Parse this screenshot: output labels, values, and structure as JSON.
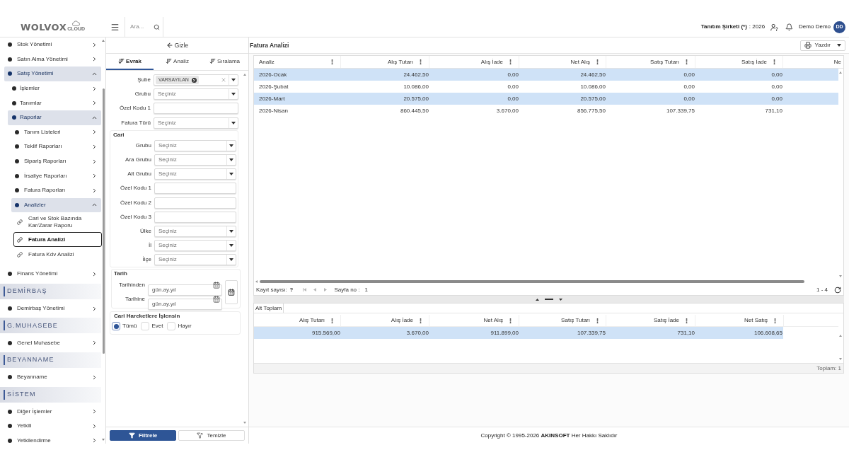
{
  "header": {
    "logo": {
      "wordmark": "WOLVOX",
      "tagline": "CLOUD"
    },
    "search": {
      "placeholder": "Ara..."
    },
    "company": {
      "name": "Tanıtım Şirketi (*)",
      "period": ": 2026"
    },
    "user": {
      "name": "Demo Demo",
      "initials": "DD"
    }
  },
  "sidebar": {
    "items": [
      {
        "kind": "node",
        "label": "Stok Yönetimi",
        "expanded": false
      },
      {
        "kind": "node",
        "label": "Satın Alma Yönetimi",
        "expanded": false
      },
      {
        "kind": "node",
        "label": "Satış Yönetimi",
        "expanded": true,
        "children": [
          {
            "kind": "node",
            "label": "İşlemler",
            "expanded": false
          },
          {
            "kind": "node",
            "label": "Tanımlar",
            "expanded": false
          },
          {
            "kind": "node",
            "label": "Raporlar",
            "expanded": true,
            "children": [
              {
                "kind": "node",
                "label": "Tanım Listeleri",
                "expanded": false
              },
              {
                "kind": "node",
                "label": "Teklif Raporları",
                "expanded": false
              },
              {
                "kind": "node",
                "label": "Sipariş Raporları",
                "expanded": false
              },
              {
                "kind": "node",
                "label": "İrsaliye Raporları",
                "expanded": false
              },
              {
                "kind": "node",
                "label": "Fatura Raporları",
                "expanded": false
              },
              {
                "kind": "node",
                "label": "Analizler",
                "expanded": true,
                "children": [
                  {
                    "kind": "link",
                    "label": "Cari ve Stok Bazında Kar/Zarar Raporu",
                    "selected": false
                  },
                  {
                    "kind": "link",
                    "label": "Fatura Analizi",
                    "selected": true
                  },
                  {
                    "kind": "link",
                    "label": "Fatura Kdv Analizi",
                    "selected": false
                  }
                ]
              }
            ]
          }
        ]
      },
      {
        "kind": "node",
        "label": "Finans Yönetimi",
        "expanded": false
      },
      {
        "kind": "header",
        "label": "DEMİRBAŞ"
      },
      {
        "kind": "node",
        "label": "Demirbaş Yönetimi",
        "expanded": false
      },
      {
        "kind": "header",
        "label": "G.MUHASEBE"
      },
      {
        "kind": "node",
        "label": "Genel Muhasebe",
        "expanded": false
      },
      {
        "kind": "header",
        "label": "BEYANNAME"
      },
      {
        "kind": "node",
        "label": "Beyanname",
        "expanded": false
      },
      {
        "kind": "header",
        "label": "SİSTEM"
      },
      {
        "kind": "node",
        "label": "Diğer İşlemler",
        "expanded": false
      },
      {
        "kind": "node",
        "label": "Yetkili",
        "expanded": false
      },
      {
        "kind": "node",
        "label": "Yetkilendirme",
        "expanded": false
      }
    ]
  },
  "filter_panel": {
    "hide_label": "Gizle",
    "tabs": [
      {
        "label": "Evrak",
        "selected": true
      },
      {
        "label": "Analiz",
        "selected": false
      },
      {
        "label": "Sıralama",
        "selected": false
      }
    ],
    "groups": [
      {
        "fields": [
          {
            "kind": "tags",
            "label": "Şube",
            "tags": [
              "VARSAYILAN"
            ]
          },
          {
            "kind": "select",
            "label": "Grubu",
            "placeholder": "Seçiniz"
          },
          {
            "kind": "text",
            "label": "Özel Kodu 1"
          },
          {
            "kind": "select",
            "label": "Fatura Türü",
            "placeholder": "Seçiniz"
          }
        ]
      },
      {
        "title": "Cari",
        "fields": [
          {
            "kind": "select",
            "label": "Grubu",
            "placeholder": "Seçiniz"
          },
          {
            "kind": "select",
            "label": "Ara Grubu",
            "placeholder": "Seçiniz"
          },
          {
            "kind": "select",
            "label": "Alt Grubu",
            "placeholder": "Seçiniz"
          },
          {
            "kind": "text",
            "label": "Özel Kodu 1"
          },
          {
            "kind": "text",
            "label": "Özel Kodu 2"
          },
          {
            "kind": "text",
            "label": "Özel Kodu 3"
          },
          {
            "kind": "select",
            "label": "Ülke",
            "placeholder": "Seçiniz"
          },
          {
            "kind": "select",
            "label": "İl",
            "placeholder": "Seçiniz"
          },
          {
            "kind": "select",
            "label": "İlçe",
            "placeholder": "Seçiniz"
          }
        ]
      }
    ],
    "date_group": {
      "title": "Tarih",
      "fields": [
        {
          "label": "Tarihinden",
          "placeholder": "gün.ay.yıl"
        },
        {
          "label": "Tarihine",
          "placeholder": "gün.ay.yıl"
        }
      ]
    },
    "radio_group": {
      "title": "Cari Hareketlere İşlensin",
      "options": [
        {
          "label": "Tümü",
          "selected": true
        },
        {
          "label": "Evet",
          "selected": false
        },
        {
          "label": "Hayır",
          "selected": false
        }
      ]
    },
    "buttons": [
      {
        "kind": "primary",
        "label": "Filtrele"
      },
      {
        "kind": "secondary",
        "label": "Temizle"
      }
    ]
  },
  "report": {
    "title": "Fatura Analizi",
    "print_label": "Yazdır",
    "table": {
      "columns": [
        {
          "label": "Analiz",
          "menu": true
        },
        {
          "label": "Alış Tutarı",
          "menu": true
        },
        {
          "label": "Alış İade",
          "menu": true
        },
        {
          "label": "Net Alış",
          "menu": true
        },
        {
          "label": "Satış Tutarı",
          "menu": true
        },
        {
          "label": "Satış İade",
          "menu": true
        },
        {
          "label": "Ne",
          "menu": false
        }
      ],
      "rows": [
        {
          "selected": true,
          "cells": [
            "2026-Ocak",
            "24.462,50",
            "0,00",
            "24.462,50",
            "0,00",
            "0,00"
          ]
        },
        {
          "selected": false,
          "cells": [
            "2026-Şubat",
            "10.086,00",
            "0,00",
            "10.086,00",
            "0,00",
            "0,00"
          ]
        },
        {
          "selected": true,
          "cells": [
            "2026-Mart",
            "20.575,00",
            "0,00",
            "20.575,00",
            "0,00",
            "0,00"
          ]
        },
        {
          "selected": false,
          "cells": [
            "2026-Nisan",
            "860.445,50",
            "3.670,00",
            "856.775,50",
            "107.339,75",
            "731,10"
          ]
        }
      ]
    },
    "pager": {
      "count_label": "Kayıt sayısı:",
      "count": "?",
      "page_label": "Sayfa no :",
      "page": "1",
      "range": "1 - 4"
    },
    "subtotal": {
      "tab": "Alt Toplam",
      "columns": [
        {
          "label": "Alış Tutarı",
          "menu": true
        },
        {
          "label": "Alış İade",
          "menu": true
        },
        {
          "label": "Net Alış",
          "menu": true
        },
        {
          "label": "Satış Tutarı",
          "menu": true
        },
        {
          "label": "Satış İade",
          "menu": true
        },
        {
          "label": "Net Satış",
          "menu": true
        }
      ],
      "rows": [
        {
          "selected": true,
          "cells": [
            "915.569,00",
            "3.670,00",
            "911.899,00",
            "107.339,75",
            "731,10",
            "106.608,65"
          ]
        }
      ],
      "footer": "Toplam: 1"
    }
  },
  "footer": {
    "copyright": "Copyright © 1995-2026 **AKINSOFT** Her Hakkı Saklıdır"
  }
}
